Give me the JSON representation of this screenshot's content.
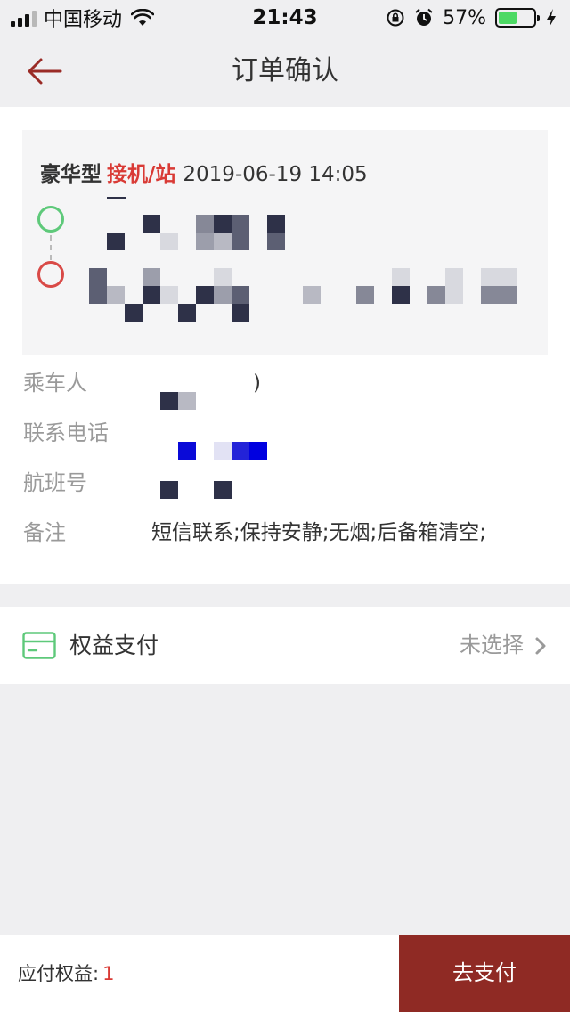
{
  "status_bar": {
    "carrier": "中国移动",
    "time": "21:43",
    "battery_percent": "57%",
    "battery_level": 0.57,
    "icons": [
      "signal-icon",
      "wifi-icon",
      "rotation-lock-icon",
      "alarm-icon",
      "battery-icon",
      "charging-icon"
    ]
  },
  "nav": {
    "title": "订单确认",
    "back_icon": "back-arrow-icon"
  },
  "trip": {
    "car_type": "豪华型",
    "service": "接机/站",
    "datetime": "2019-06-19 14:05"
  },
  "info": {
    "passenger": {
      "label": "乘车人",
      "value": ")"
    },
    "phone": {
      "label": "联系电话",
      "value": ""
    },
    "flight": {
      "label": "航班号",
      "value": ""
    },
    "remark": {
      "label": "备注",
      "value": "短信联系;保持安静;无烟;后备箱清空;"
    }
  },
  "payment": {
    "label": "权益支付",
    "status": "未选择",
    "icon": "card-icon"
  },
  "bottom": {
    "due_label": "应付权益:",
    "due_value": "1",
    "pay_button": "去支付"
  },
  "colors": {
    "accent_red": "#d93a35",
    "pay_button": "#8f2a24",
    "start_dot": "#5ec97a",
    "end_dot": "#d94a47",
    "background": "#efeff1"
  }
}
